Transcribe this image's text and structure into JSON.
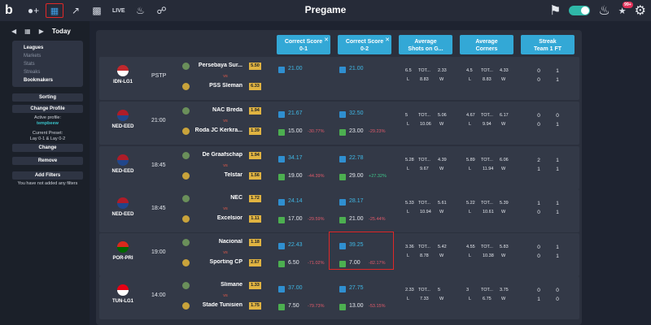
{
  "header": {
    "logo": "b",
    "title": "Pregame",
    "live_label": "LIVE",
    "notif_count": "99+"
  },
  "sidebar": {
    "date_label": "Today",
    "menu": [
      "Leagues",
      "Markets",
      "Stats",
      "Streaks",
      "Bookmakers"
    ],
    "sorting": "Sorting",
    "change_profile": "Change Profile",
    "active_profile_label": "Active profile:",
    "active_profile_value": "tempbeew",
    "current_preset_label": "Current Preset:",
    "current_preset_value": "Lay 0-1 & Lay 0-2",
    "change": "Change",
    "remove": "Remove",
    "add_filters": "Add Filters",
    "no_filters": "You have not added any filters"
  },
  "columns": {
    "cs01": [
      "Correct Score",
      "0-1"
    ],
    "cs02": [
      "Correct Score",
      "0-2"
    ],
    "shots": [
      "Average",
      "Shots on G..."
    ],
    "corners": [
      "Average",
      "Corners"
    ],
    "streak": [
      "Streak",
      "Team 1 FT"
    ]
  },
  "rows": [
    {
      "league": "IDN-LG1",
      "time": "PSTP",
      "home": "Persebaya Sur...",
      "away": "PSS Sleman",
      "home_odd": "5.50",
      "away_odd": "6.33",
      "cs01_top": "21.00",
      "cs01_bot": "",
      "cs01_pct": "",
      "cs02_top": "21.00",
      "cs02_bot": "",
      "cs02_pct": "",
      "sh": [
        "6.5",
        "TOT...",
        "2.33",
        "L",
        "8.83",
        "W"
      ],
      "co": [
        "4.5",
        "TOT...",
        "4.33",
        "L",
        "8.83",
        "W"
      ],
      "st": [
        "0",
        "1",
        "0",
        "1"
      ],
      "flag": "#c0282d",
      "flag2": "#ffffff",
      "pct_color": "neg"
    },
    {
      "league": "NED-EED",
      "time": "21:00",
      "home": "NAC Breda",
      "away": "Roda JC Kerkra...",
      "home_odd": "1.94",
      "away_odd": "1.39",
      "cs01_top": "21.67",
      "cs01_bot": "15.00",
      "cs01_pct": "-30.77%",
      "cs02_top": "32.50",
      "cs02_bot": "23.00",
      "cs02_pct": "-29.23%",
      "sh": [
        "5",
        "TOT...",
        "5.06",
        "L",
        "10.06",
        "W"
      ],
      "co": [
        "4.67",
        "TOT...",
        "6.17",
        "L",
        "9.94",
        "W"
      ],
      "st": [
        "0",
        "0",
        "0",
        "1"
      ],
      "flag": "#ae1c28",
      "flag2": "#21468b",
      "pct_color": "neg"
    },
    {
      "league": "NED-EED",
      "time": "18:45",
      "home": "De Graafschap",
      "away": "Telstar",
      "home_odd": "1.94",
      "away_odd": "1.56",
      "cs01_top": "34.17",
      "cs01_bot": "19.00",
      "cs01_pct": "-44.39%",
      "cs02_top": "22.78",
      "cs02_bot": "29.00",
      "cs02_pct": "+27.32%",
      "sh": [
        "5.28",
        "TOT...",
        "4.39",
        "L",
        "9.67",
        "W"
      ],
      "co": [
        "5.89",
        "TOT...",
        "6.06",
        "L",
        "11.94",
        "W"
      ],
      "st": [
        "2",
        "1",
        "1",
        "1"
      ],
      "flag": "#ae1c28",
      "flag2": "#21468b",
      "pct_color": "mix"
    },
    {
      "league": "NED-EED",
      "time": "18:45",
      "home": "NEC",
      "away": "Excelsior",
      "home_odd": "1.72",
      "away_odd": "1.11",
      "cs01_top": "24.14",
      "cs01_bot": "17.00",
      "cs01_pct": "-29.59%",
      "cs02_top": "28.17",
      "cs02_bot": "21.00",
      "cs02_pct": "-25.44%",
      "sh": [
        "5.33",
        "TOT...",
        "5.61",
        "L",
        "10.94",
        "W"
      ],
      "co": [
        "5.22",
        "TOT...",
        "5.39",
        "L",
        "10.61",
        "W"
      ],
      "st": [
        "1",
        "1",
        "0",
        "1"
      ],
      "flag": "#ae1c28",
      "flag2": "#21468b",
      "pct_color": "neg"
    },
    {
      "league": "POR-PRI",
      "time": "19:00",
      "home": "Nacional",
      "away": "Sporting CP",
      "home_odd": "1.18",
      "away_odd": "2.67",
      "cs01_top": "22.43",
      "cs01_bot": "6.50",
      "cs01_pct": "-71.02%",
      "cs02_top": "39.25",
      "cs02_bot": "7.00",
      "cs02_pct": "-82.17%",
      "sh": [
        "3.36",
        "TOT...",
        "5.42",
        "L",
        "8.78",
        "W"
      ],
      "co": [
        "4.55",
        "TOT...",
        "5.83",
        "L",
        "10.38",
        "W"
      ],
      "st": [
        "0",
        "1",
        "0",
        "1"
      ],
      "flag": "#da291c",
      "flag2": "#006600",
      "pct_color": "neg"
    },
    {
      "league": "TUN-LG1",
      "time": "14:00",
      "home": "Slimane",
      "away": "Stade Tunisien",
      "home_odd": "1.33",
      "away_odd": "1.75",
      "cs01_top": "37.00",
      "cs01_bot": "7.50",
      "cs01_pct": "-79.73%",
      "cs02_top": "27.75",
      "cs02_bot": "13.00",
      "cs02_pct": "-53.15%",
      "sh": [
        "2.33",
        "TOT...",
        "5",
        "L",
        "7.33",
        "W"
      ],
      "co": [
        "3",
        "TOT...",
        "3.75",
        "L",
        "6.75",
        "W"
      ],
      "st": [
        "0",
        "0",
        "1",
        "0"
      ],
      "flag": "#e70013",
      "flag2": "#ffffff",
      "pct_color": "neg"
    }
  ],
  "colors": {
    "accent": "#33a8d6",
    "negative": "#e05a6a",
    "positive": "#3fc68a",
    "highlight": "#e02828"
  }
}
